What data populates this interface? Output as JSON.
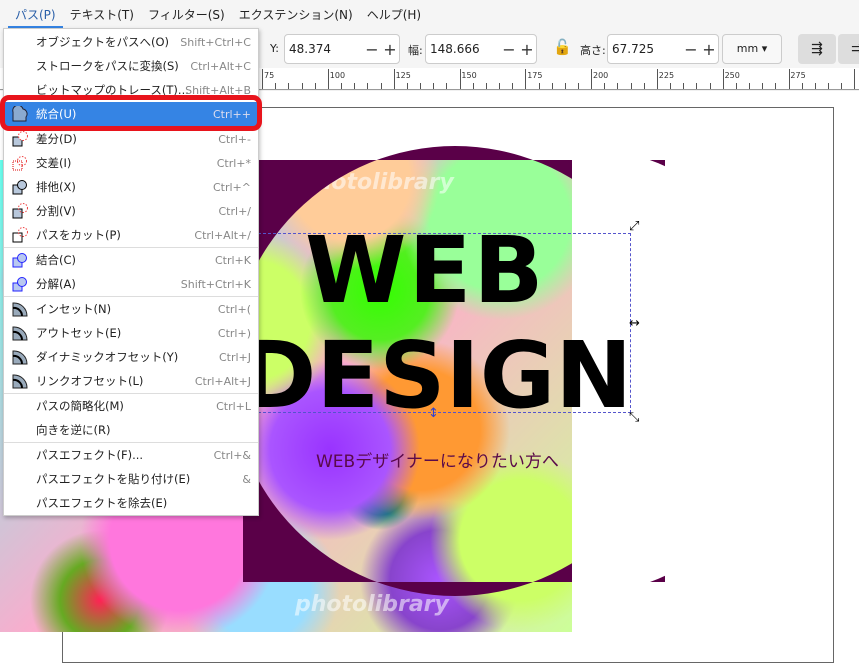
{
  "menubar": {
    "items": [
      {
        "label": "パス(P)"
      },
      {
        "label": "テキスト(T)"
      },
      {
        "label": "フィルター(S)"
      },
      {
        "label": "エクステンション(N)"
      },
      {
        "label": "ヘルプ(H)"
      }
    ]
  },
  "toolbar": {
    "y_label": "Y:",
    "y_value": "48.374",
    "w_label": "幅:",
    "w_value": "148.666",
    "h_label": "高さ:",
    "h_value": "67.725",
    "unit": "mm",
    "minus": "−",
    "plus": "+"
  },
  "ruler": {
    "labels": [
      "75",
      "100",
      "125",
      "150",
      "175",
      "200",
      "225",
      "250",
      "275"
    ]
  },
  "path_menu": {
    "items": [
      {
        "label": "オブジェクトをパスへ(O)",
        "shortcut": "Shift+Ctrl+C",
        "icon": "none"
      },
      {
        "label": "ストロークをパスに変換(S)",
        "shortcut": "Ctrl+Alt+C",
        "icon": "none"
      },
      {
        "label": "ビットマップのトレース(T)...",
        "shortcut": "Shift+Alt+B",
        "icon": "none"
      },
      {
        "label": "統合(U)",
        "shortcut": "Ctrl++",
        "icon": "union-icon",
        "highlighted": true
      },
      {
        "label": "差分(D)",
        "shortcut": "Ctrl+-",
        "icon": "difference-icon"
      },
      {
        "label": "交差(I)",
        "shortcut": "Ctrl+*",
        "icon": "intersection-icon"
      },
      {
        "label": "排他(X)",
        "shortcut": "Ctrl+^",
        "icon": "exclusion-icon"
      },
      {
        "label": "分割(V)",
        "shortcut": "Ctrl+/",
        "icon": "division-icon"
      },
      {
        "label": "パスをカット(P)",
        "shortcut": "Ctrl+Alt+/",
        "icon": "cut-path-icon"
      },
      {
        "label": "結合(C)",
        "shortcut": "Ctrl+K",
        "icon": "combine-icon"
      },
      {
        "label": "分解(A)",
        "shortcut": "Shift+Ctrl+K",
        "icon": "break-apart-icon"
      },
      {
        "label": "インセット(N)",
        "shortcut": "Ctrl+(",
        "icon": "inset-icon"
      },
      {
        "label": "アウトセット(E)",
        "shortcut": "Ctrl+)",
        "icon": "outset-icon"
      },
      {
        "label": "ダイナミックオフセット(Y)",
        "shortcut": "Ctrl+J",
        "icon": "dynamic-offset-icon"
      },
      {
        "label": "リンクオフセット(L)",
        "shortcut": "Ctrl+Alt+J",
        "icon": "linked-offset-icon"
      },
      {
        "label": "パスの簡略化(M)",
        "shortcut": "Ctrl+L",
        "icon": "none"
      },
      {
        "label": "向きを逆に(R)",
        "shortcut": "",
        "icon": "none"
      },
      {
        "label": "パスエフェクト(F)...",
        "shortcut": "Ctrl+&",
        "icon": "none"
      },
      {
        "label": "パスエフェクトを貼り付け(E)",
        "shortcut": "&",
        "icon": "none"
      },
      {
        "label": "パスエフェクトを除去(E)",
        "shortcut": "",
        "icon": "none"
      }
    ]
  },
  "canvas": {
    "title_line1": "WEB",
    "title_line2": "DESIGN",
    "subtitle": "WEBデザイナーになりたい方へ",
    "watermark": "photolibrary"
  },
  "colors": {
    "accent": "#3584e4",
    "highlight_box": "#e8141c",
    "background_shape": "#5a0048",
    "subtitle": "#5a0a4a"
  }
}
